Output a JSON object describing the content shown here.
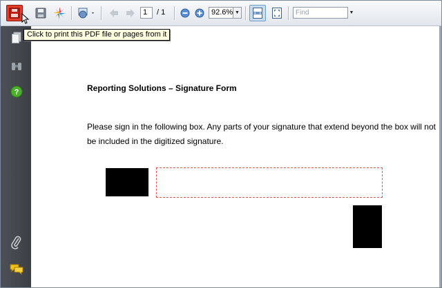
{
  "toolbar": {
    "page_current": "1",
    "page_total": "/ 1",
    "zoom_value": "92.6%",
    "find_placeholder": "Find"
  },
  "tooltip": {
    "text": "Click to print this PDF file or pages from it"
  },
  "document": {
    "title": "Reporting Solutions – Signature Form",
    "instructions": "Please sign in the following box.  Any parts of your signature that extend beyond the box will not be included in the digitized signature."
  },
  "icons": {
    "print": "print-icon",
    "save": "save-icon",
    "collaborate": "collaborate-icon",
    "send": "send-icon",
    "prev_page": "previous-page-icon",
    "next_page": "next-page-icon",
    "zoom_out": "zoom-out-icon",
    "zoom_in": "zoom-in-icon",
    "fit_width": "fit-width-icon",
    "fit_window": "fit-window-icon",
    "pages": "pages-icon",
    "binoculars": "binoculars-icon",
    "help": "help-icon",
    "attachments": "attachments-icon",
    "comments": "comments-icon"
  },
  "colors": {
    "print_highlight": "#e23c2a",
    "sig_box_border": "#e0524c",
    "help_green": "#4caf2c",
    "sidebar": "#45494e"
  }
}
